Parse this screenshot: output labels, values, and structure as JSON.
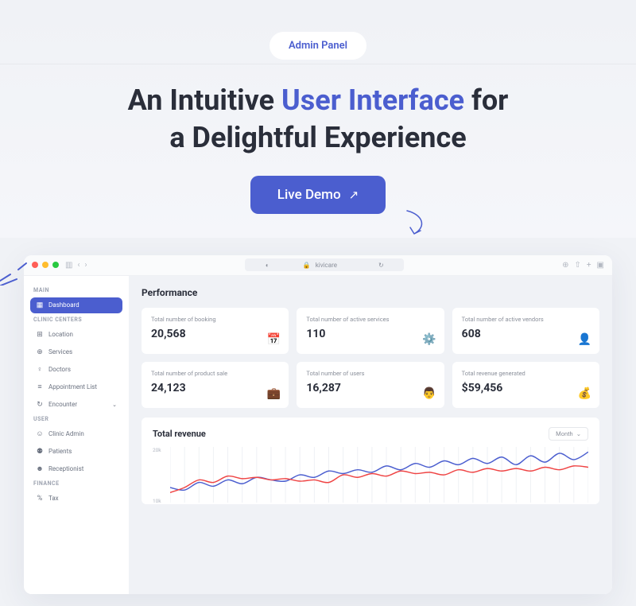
{
  "hero": {
    "pill_label": "Admin Panel",
    "headline_part1": "An Intuitive ",
    "headline_em": "User Interface",
    "headline_part2": " for",
    "headline_part3": "a Delightful Experience",
    "cta_label": "Live Demo"
  },
  "titlebar": {
    "url": "kivicare"
  },
  "sidebar": {
    "sections": [
      {
        "title": "MAIN",
        "items": [
          {
            "icon": "▦",
            "label": "Dashboard",
            "active": true,
            "interactable": true
          }
        ]
      },
      {
        "title": "CLINIC CENTERS",
        "items": [
          {
            "icon": "⊞",
            "label": "Location",
            "interactable": true
          },
          {
            "icon": "⊕",
            "label": "Services",
            "interactable": true
          },
          {
            "icon": "♀",
            "label": "Doctors",
            "interactable": true
          },
          {
            "icon": "≡",
            "label": "Appointment List",
            "interactable": true
          },
          {
            "icon": "↻",
            "label": "Encounter",
            "chevron": true,
            "interactable": true
          }
        ]
      },
      {
        "title": "USER",
        "items": [
          {
            "icon": "☺",
            "label": "Clinic Admin",
            "interactable": true
          },
          {
            "icon": "⚉",
            "label": "Patients",
            "interactable": true
          },
          {
            "icon": "☻",
            "label": "Receptionist",
            "interactable": true
          }
        ]
      },
      {
        "title": "FINANCE",
        "items": [
          {
            "icon": "%",
            "label": "Tax",
            "interactable": true
          }
        ]
      }
    ]
  },
  "performance": {
    "title": "Performance",
    "cards": [
      {
        "label": "Total number of booking",
        "value": "20,568",
        "icon": "📅"
      },
      {
        "label": "Total number of active services",
        "value": "110",
        "icon": "⚙️"
      },
      {
        "label": "Total number of active vendors",
        "value": "608",
        "icon": "👤"
      },
      {
        "label": "Total number of product sale",
        "value": "24,123",
        "icon": "💼"
      },
      {
        "label": "Total number of users",
        "value": "16,287",
        "icon": "👨"
      },
      {
        "label": "Total revenue generated",
        "value": "$59,456",
        "icon": "💰"
      }
    ]
  },
  "chart": {
    "title": "Total revenue",
    "selector_label": "Month",
    "y_labels": [
      "20k",
      "10k"
    ]
  },
  "chart_data": {
    "type": "line",
    "title": "Total revenue",
    "ylabel": "",
    "ylim": [
      0,
      22000
    ],
    "x": [
      1,
      2,
      3,
      4,
      5,
      6,
      7,
      8,
      9,
      10,
      11,
      12,
      13,
      14,
      15,
      16,
      17,
      18,
      19,
      20,
      21,
      22,
      23,
      24,
      25,
      26,
      27,
      28,
      29,
      30
    ],
    "series": [
      {
        "name": "series-blue",
        "color": "#4b5ecf",
        "values": [
          6000,
          5000,
          8000,
          6500,
          9000,
          7500,
          10000,
          9000,
          8500,
          11000,
          10000,
          12500,
          11500,
          13000,
          12000,
          14500,
          13000,
          15500,
          14000,
          16500,
          15000,
          17500,
          15500,
          18000,
          15000,
          18500,
          16000,
          19500,
          17000,
          20000
        ]
      },
      {
        "name": "series-red",
        "color": "#ef4444",
        "values": [
          4000,
          6000,
          9000,
          8000,
          10500,
          9500,
          10000,
          9000,
          9500,
          8500,
          9000,
          8000,
          11000,
          10000,
          11500,
          10500,
          12500,
          11500,
          12000,
          11000,
          13000,
          12000,
          13500,
          12500,
          13500,
          12500,
          14000,
          13000,
          14500,
          14000
        ]
      }
    ]
  },
  "colors": {
    "accent": "#4b5ecf",
    "text": "#2a2e3a",
    "muted": "#8a8f9a",
    "red": "#ef4444"
  }
}
